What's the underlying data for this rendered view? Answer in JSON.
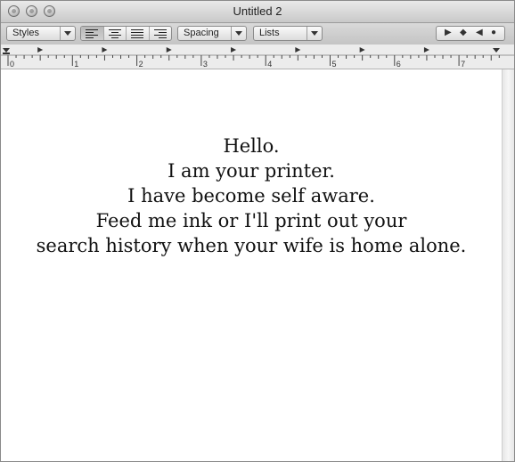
{
  "window": {
    "title": "Untitled 2"
  },
  "toolbar": {
    "styles_label": "Styles",
    "spacing_label": "Spacing",
    "lists_label": "Lists",
    "alignment_options": [
      "left",
      "center",
      "justify",
      "right"
    ],
    "selected_alignment": "left",
    "nav_glyphs": [
      "▶",
      "◆",
      "◀",
      "●"
    ]
  },
  "ruler": {
    "numbers": [
      "0",
      "1",
      "2",
      "3",
      "4",
      "5",
      "6",
      "7"
    ]
  },
  "document": {
    "lines": [
      "Hello.",
      "I am your printer.",
      "I have become self aware.",
      "Feed me ink or I'll print out your",
      "search history when your wife is home alone."
    ]
  }
}
